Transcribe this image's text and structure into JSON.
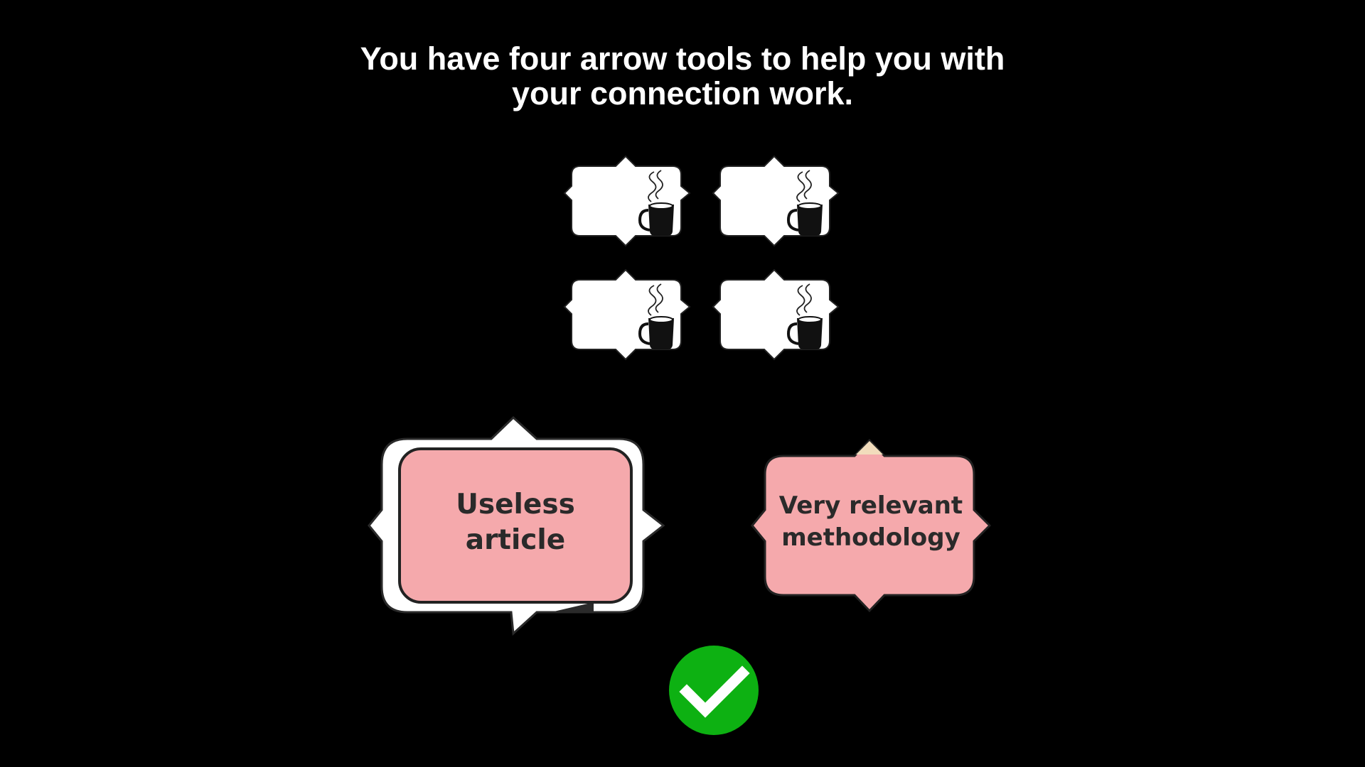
{
  "instruction": {
    "line1": "You have four arrow tools to help you with",
    "line2": "your connection work."
  },
  "tools": [
    {
      "icon": "coffee-mug-icon"
    },
    {
      "icon": "coffee-mug-icon"
    },
    {
      "icon": "coffee-mug-icon"
    },
    {
      "icon": "coffee-mug-icon"
    }
  ],
  "cards": [
    {
      "line1": "Useless",
      "line2": "article",
      "state": "selected"
    },
    {
      "line1": "Very relevant",
      "line2": "methodology",
      "state": "default"
    }
  ],
  "colors": {
    "background": "#000000",
    "card_fill": "#f5a9ac",
    "card_border": "#222222",
    "tool_fill": "#ffffff",
    "check_fill": "#0db112"
  },
  "check": {
    "icon": "checkmark-icon"
  }
}
